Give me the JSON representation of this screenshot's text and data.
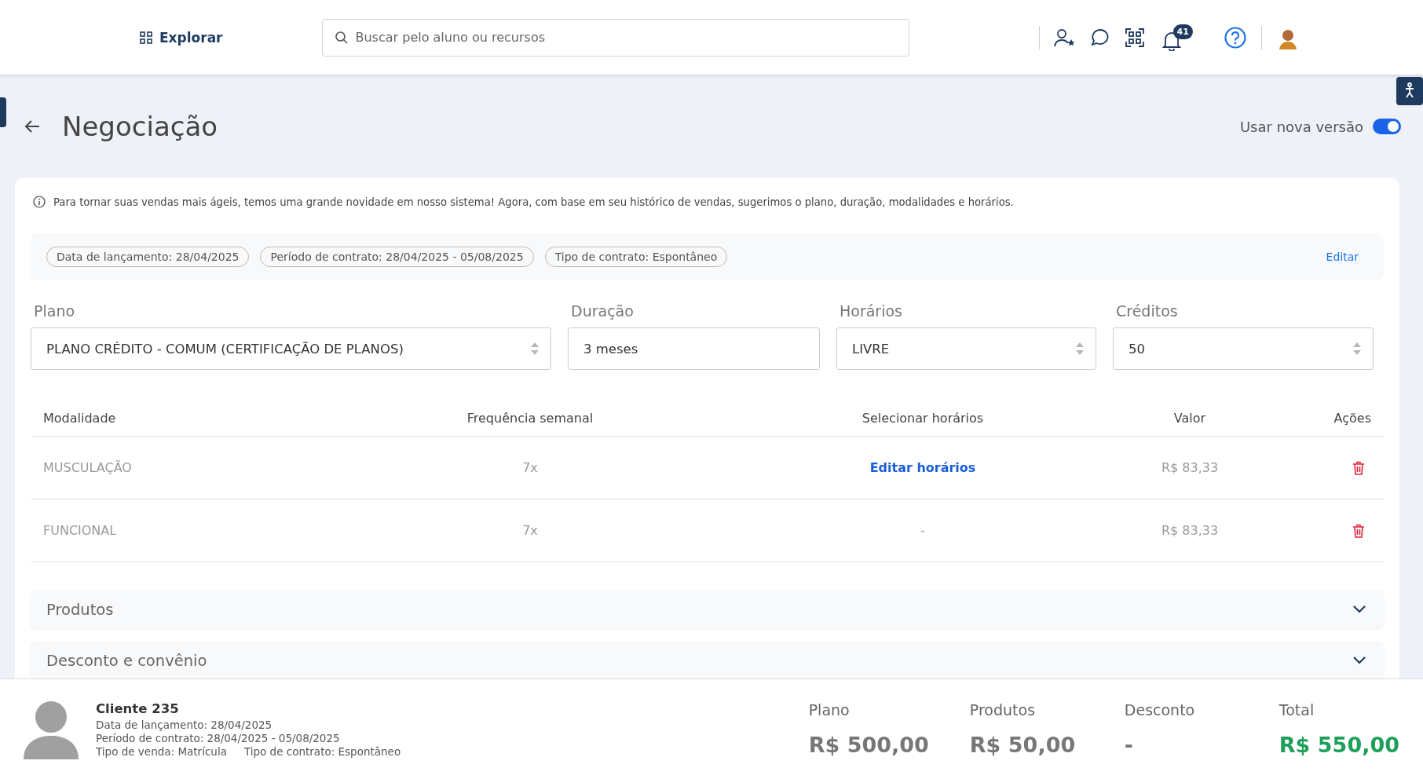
{
  "header": {
    "explore": "Explorar",
    "search": {
      "placeholder": "Buscar pelo aluno ou recursos"
    },
    "notifications": "41"
  },
  "page": {
    "title": "Negociação",
    "new_version": {
      "label": "Usar nova versão",
      "on": true
    }
  },
  "info": "Para tornar suas vendas mais ágeis, temos uma grande novidade em nosso sistema! Agora, com base em seu histórico de vendas, sugerimos o plano, duração, modalidades e horários.",
  "chips": [
    "Data de lançamento: 28/04/2025",
    "Período de contrato: 28/04/2025 - 05/08/2025",
    "Tipo de contrato: Espontâneo"
  ],
  "edit_link": "Editar",
  "fields": [
    {
      "label": "Plano",
      "value": "PLANO CRÉDITO - COMUM (CERTIFICAÇÃO DE PLANOS)",
      "arrows": true
    },
    {
      "label": "Duração",
      "value": "3 meses",
      "arrows": false
    },
    {
      "label": "Horários",
      "value": "LIVRE",
      "arrows": true
    },
    {
      "label": "Créditos",
      "value": "50",
      "arrows": true
    }
  ],
  "table": {
    "columns": [
      "Modalidade",
      "Frequência semanal",
      "Selecionar horários",
      "Valor",
      "Ações"
    ],
    "rows": [
      {
        "modality": "MUSCULAÇÃO",
        "frequency": "7x",
        "schedule": {
          "kind": "link",
          "text": "Editar horários"
        },
        "value": "R$ 83,33"
      },
      {
        "modality": "FUNCIONAL",
        "frequency": "7x",
        "schedule": {
          "kind": "text",
          "text": "-"
        },
        "value": "R$ 83,33"
      }
    ]
  },
  "sections": [
    {
      "title": "Produtos",
      "expanded": false
    },
    {
      "title": "Desconto e convênio",
      "expanded": false
    }
  ],
  "footer": {
    "client": "Cliente 235",
    "details": [
      "Data de lançamento: 28/04/2025",
      "Período de contrato: 28/04/2025 - 05/08/2025"
    ],
    "sale_type": "Tipo de venda: Matrícula",
    "contract_type": "Tipo de contrato: Espontâneo",
    "totals": [
      {
        "label": "Plano",
        "value": "R$ 500,00",
        "kind": "normal"
      },
      {
        "label": "Produtos",
        "value": "R$ 50,00",
        "kind": "normal"
      },
      {
        "label": "Desconto",
        "value": "-",
        "kind": "normal"
      },
      {
        "label": "Total",
        "value": "R$ 550,00",
        "kind": "total"
      }
    ]
  }
}
